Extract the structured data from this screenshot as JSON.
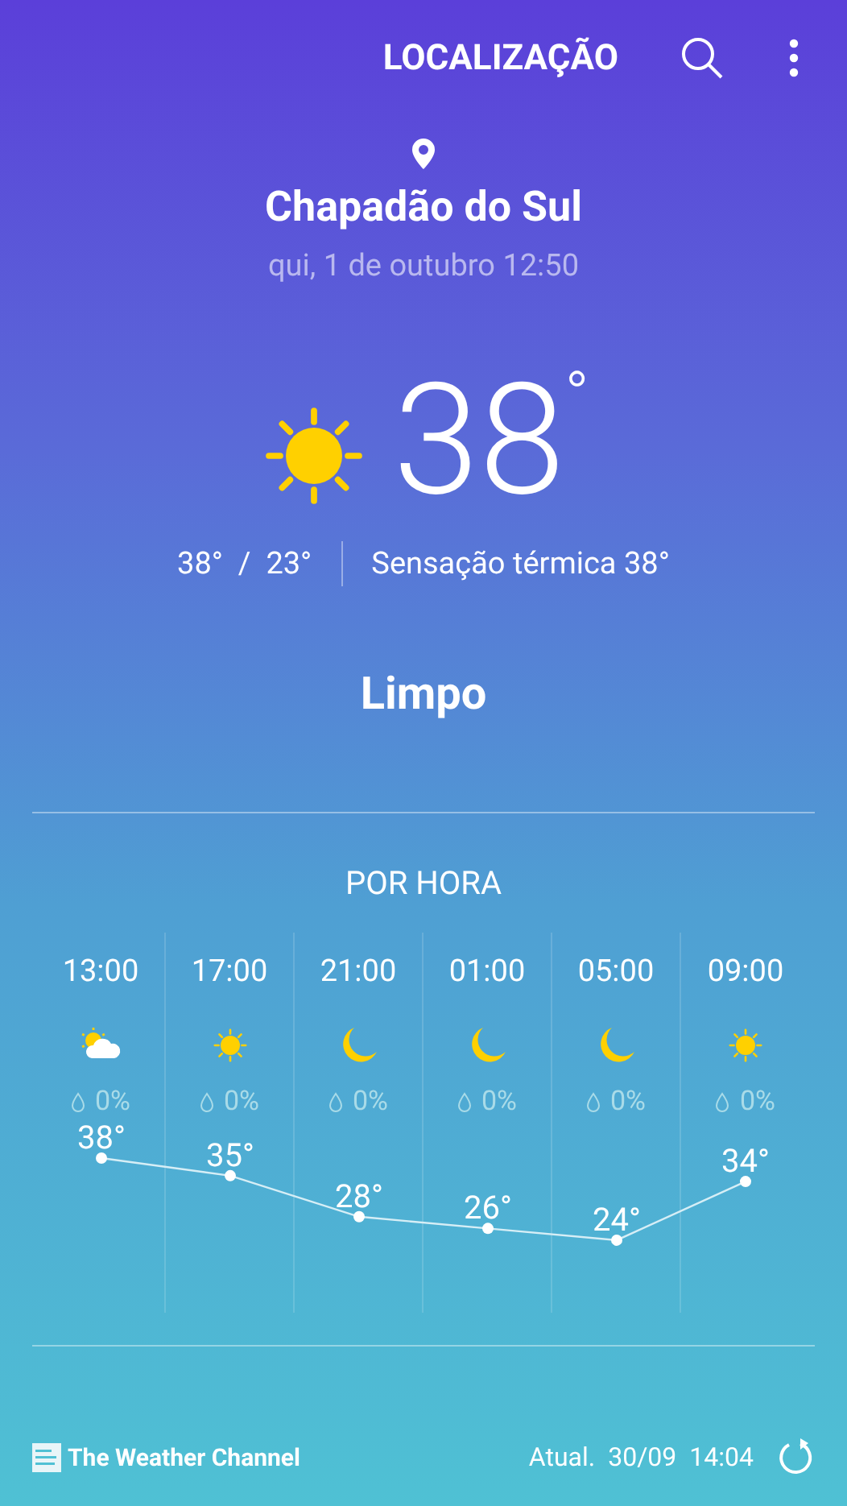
{
  "header": {
    "title": "LOCALIZAÇÃO"
  },
  "location": {
    "city": "Chapadão do Sul",
    "datetime": "qui, 1 de outubro 12:50"
  },
  "current": {
    "kind": "sun",
    "temp": "38",
    "degree": "°",
    "high_low": "38°  /  23°",
    "feels_like": "Sensação térmica 38°",
    "condition": "Limpo"
  },
  "hourly": {
    "title": "POR HORA",
    "items": [
      {
        "time": "13:00",
        "kind": "partly-cloudy",
        "precip": "0%",
        "temp": "38°"
      },
      {
        "time": "17:00",
        "kind": "sun",
        "precip": "0%",
        "temp": "35°"
      },
      {
        "time": "21:00",
        "kind": "moon",
        "precip": "0%",
        "temp": "28°"
      },
      {
        "time": "01:00",
        "kind": "moon",
        "precip": "0%",
        "temp": "26°"
      },
      {
        "time": "05:00",
        "kind": "moon",
        "precip": "0%",
        "temp": "24°"
      },
      {
        "time": "09:00",
        "kind": "sun",
        "precip": "0%",
        "temp": "34°"
      }
    ]
  },
  "footer": {
    "provider": "The Weather Channel",
    "updated_label": "Atual.",
    "updated_date": "30/09",
    "updated_time": "14:04"
  }
}
